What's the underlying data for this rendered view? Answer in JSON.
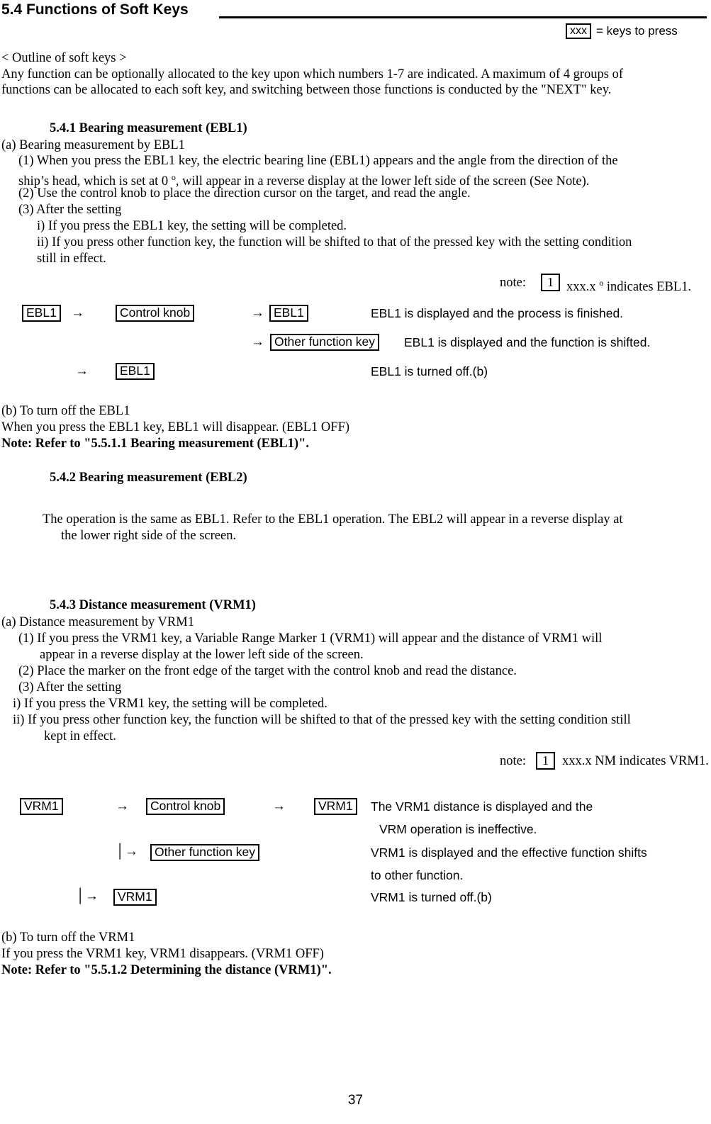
{
  "header": {
    "title": "5.4 Functions of Soft Keys",
    "legend": {
      "key_box": "xxx",
      "label": "= keys to press"
    }
  },
  "outline": {
    "heading": "< Outline of soft keys >",
    "line1": "Any function can be optionally allocated to the key upon which numbers 1-7 are indicated.  A maximum of 4 groups of",
    "line2": "functions can be allocated to each soft key, and switching between those functions is conducted by the \"NEXT\" key."
  },
  "section_541": {
    "heading": "5.4.1 Bearing measurement (EBL1)",
    "a_label": "(a)  Bearing measurement by EBL1",
    "item1_line1": "(1)  When you press the EBL1 key, the electric bearing line (EBL1) appears and the angle from the direction of the",
    "item1_line2_a": "ship’s head, which is set at 0 ",
    "item1_line2_deg": "o",
    "item1_line2_b": ", will appear in a reverse display at the lower left side of the screen (See Note).",
    "item2": "(2)  Use the control knob to place the direction cursor on the target, and read the angle.",
    "item3": "(3)  After the setting",
    "item3_i": "i)  If you press the EBL1 key, the setting will be completed.",
    "item3_ii_line1": "ii)  If you press other function key, the function will be shifted to that of the pressed key with the setting condition",
    "item3_ii_line2": "still in effect.",
    "note_label": "note:",
    "note_box": "1",
    "note_text_a": "xxx.x ",
    "note_text_deg": "o",
    "note_text_b": " indicates EBL1.",
    "diagram": {
      "key_ebl1_start": "EBL1",
      "arrow1": "→",
      "key_control_knob": "Control knob",
      "arrow2": "→",
      "key_ebl1_second": "EBL1",
      "result1": "EBL1 is displayed and the process is finished.",
      "arrow3": "→",
      "key_other_function": "Other function key",
      "result2": "EBL1 is displayed and the function is shifted.",
      "arrow4": "→",
      "key_ebl1_third": "EBL1",
      "result3": "EBL1 is turned off.(b)"
    },
    "b_line1": "(b)  To turn off the EBL1",
    "b_line2": "  When you press the EBL1 key, EBL1 will disappear.  (EBL1 OFF)",
    "note_refer": "Note: Refer to \"5.5.1.1 Bearing measurement (EBL1)\"."
  },
  "section_542": {
    "heading": "5.4.2 Bearing measurement (EBL2)",
    "body_line1": "The operation is the same as EBL1. Refer to the EBL1 operation. The EBL2 will appear in a reverse display at",
    "body_line2": "the lower right side of the screen."
  },
  "section_543": {
    "heading": "5.4.3 Distance measurement (VRM1)",
    "a_label": "(a)  Distance measurement by VRM1",
    "item1_line1": "(1)  If you press the VRM1 key, a Variable Range Marker 1 (VRM1) will appear and the distance of VRM1 will",
    "item1_line2": "appear in a reverse display at the lower left side of the screen.",
    "item2": "(2)  Place the marker on the front edge of the target with the control knob and read the distance.",
    "item3": "(3)  After the setting",
    "item3_i": "i)  If you press the VRM1 key, the setting will be completed.",
    "item3_ii_line1": "ii)  If you press other function key, the function will be shifted to that of the pressed key with the  setting condition still",
    "item3_ii_line2": "kept in effect.",
    "note_label": "note:",
    "note_box": "1",
    "note_text": "xxx.x NM indicates VRM1.",
    "diagram": {
      "key_vrm1_start": "VRM1",
      "arrow1": "→",
      "key_control_knob": "Control knob",
      "arrow2": "→",
      "key_vrm1_second": "VRM1",
      "result1_line1": "The VRM1 distance is displayed and the",
      "result1_line2": "VRM operation is ineffective.",
      "arrow3": "│→",
      "key_other_function": "Other function key",
      "result2_line1": "VRM1 is displayed and the effective function shifts",
      "result2_line2": "to other function.",
      "arrow4": "│→",
      "key_vrm1_third": "VRM1",
      "result3": "VRM1 is turned off.(b)"
    },
    "b_line1": "(b)  To turn off the VRM1",
    "b_line2": "  If you press the VRM1 key, VRM1 disappears.  (VRM1 OFF)",
    "note_refer": "Note: Refer to \"5.5.1.2 Determining the distance (VRM1)\"."
  },
  "footer": {
    "page_number": "37"
  }
}
